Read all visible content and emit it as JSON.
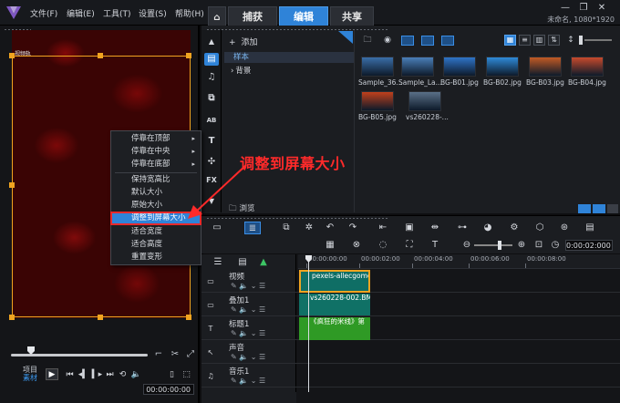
{
  "menu": {
    "file": "文件(F)",
    "edit": "编辑(E)",
    "tools": "工具(T)",
    "settings": "设置(S)",
    "help": "帮助(H)"
  },
  "tabs": {
    "capture": "捕获",
    "edit": "编辑",
    "share": "共享"
  },
  "project_info": "未命名, 1080*1920",
  "preview": {
    "canvas_label": "视频轨",
    "mode_project": "项目",
    "mode_clip": "素材",
    "timecode": "00:00:00:00"
  },
  "context_menu": {
    "items": [
      "停靠在顶部",
      "停靠在中央",
      "停靠在底部",
      "保持宽高比",
      "默认大小",
      "原始大小",
      "调整到屏幕大小",
      "适合宽度",
      "适合高度",
      "重置变形"
    ],
    "highlighted_index": 6
  },
  "annotation": "调整到屏幕大小",
  "library": {
    "add": "添加",
    "folders": [
      "样本",
      "背景"
    ],
    "browse": "浏览",
    "thumbnails": [
      {
        "label": "Sample_36...",
        "color": "#3a6ea8"
      },
      {
        "label": "Sample_La...",
        "color": "#4a7fb8"
      },
      {
        "label": "BG-B01.jpg",
        "color": "#2f74c8"
      },
      {
        "label": "BG-B02.jpg",
        "color": "#2f8ad8"
      },
      {
        "label": "BG-B03.jpg",
        "color": "#c25a24"
      },
      {
        "label": "BG-B04.jpg",
        "color": "#c84a2c"
      },
      {
        "label": "BG-B05.jpg",
        "color": "#c0401c"
      },
      {
        "label": "vs260228-...",
        "color": "#5a7088"
      }
    ]
  },
  "timeline": {
    "timecode": "0:00:02:000",
    "ruler": [
      "00:00:00:00",
      "00:00:02:00",
      "00:00:04:00",
      "00:00:06:00",
      "00:00:08:00"
    ],
    "tracks": [
      {
        "name": "视频",
        "clip": "pexels-allecgomes"
      },
      {
        "name": "叠加1",
        "clip": "vs260228-002.BMP"
      },
      {
        "name": "标题1",
        "clip": "《疯狂的米线》第"
      },
      {
        "name": "声音",
        "clip": ""
      },
      {
        "name": "音乐1",
        "clip": ""
      }
    ]
  },
  "colors": {
    "accent": "#2f83d8",
    "selection_frame": "#f0a420",
    "annotation": "#ff2a2a",
    "video_clip": "#0f6e65",
    "title_clip": "#2f9a25"
  }
}
